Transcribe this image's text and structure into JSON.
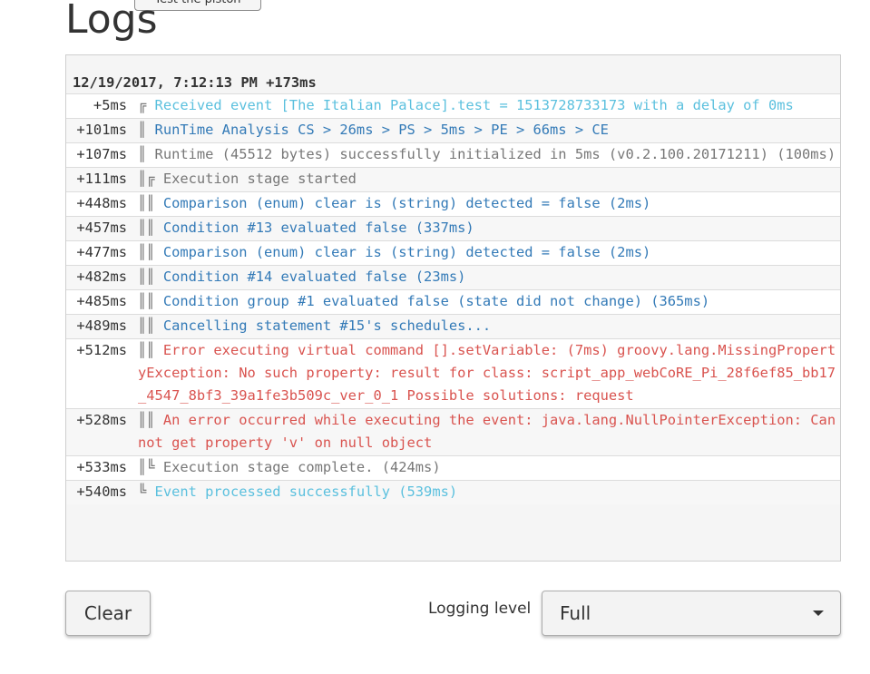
{
  "page": {
    "title": "Logs",
    "top_button_label": "Test the piston"
  },
  "log": {
    "header": "12/19/2017, 7:12:13 PM +173ms",
    "entries": [
      {
        "time": "+5ms",
        "prefix": "╔ ",
        "text": "Received event [The Italian Palace].test = 1513728733173 with a delay of 0ms",
        "level": "info"
      },
      {
        "time": "+101ms",
        "prefix": "║ ",
        "text": "RunTime Analysis CS > 26ms > PS > 5ms > PE > 66ms > CE",
        "level": "trace"
      },
      {
        "time": "+107ms",
        "prefix": "║ ",
        "text": "Runtime (45512 bytes) successfully initialized in 5ms (v0.2.100.20171211) (100ms)",
        "level": "plain"
      },
      {
        "time": "+111ms",
        "prefix": "║╔ ",
        "text": "Execution stage started",
        "level": "plain"
      },
      {
        "time": "+448ms",
        "prefix": "║║ ",
        "text": "Comparison (enum) clear is (string) detected = false (2ms)",
        "level": "trace"
      },
      {
        "time": "+457ms",
        "prefix": "║║ ",
        "text": "Condition #13 evaluated false (337ms)",
        "level": "trace"
      },
      {
        "time": "+477ms",
        "prefix": "║║ ",
        "text": "Comparison (enum) clear is (string) detected = false (2ms)",
        "level": "trace"
      },
      {
        "time": "+482ms",
        "prefix": "║║ ",
        "text": "Condition #14 evaluated false (23ms)",
        "level": "trace"
      },
      {
        "time": "+485ms",
        "prefix": "║║ ",
        "text": "Condition group #1 evaluated false (state did not change) (365ms)",
        "level": "trace"
      },
      {
        "time": "+489ms",
        "prefix": "║║ ",
        "text": "Cancelling statement #15's schedules...",
        "level": "trace"
      },
      {
        "time": "+512ms",
        "prefix": "║║ ",
        "text": "Error executing virtual command [].setVariable: (7ms) groovy.lang.MissingPropertyException: No such property: result for class: script_app_webCoRE_Pi_28f6ef85_bb17_4547_8bf3_39a1fe3b509c_ver_0_1 Possible solutions: request",
        "level": "error"
      },
      {
        "time": "+528ms",
        "prefix": "║║ ",
        "text": "An error occurred while executing the event: java.lang.NullPointerException: Cannot get property 'v' on null object",
        "level": "error"
      },
      {
        "time": "+533ms",
        "prefix": "║╚ ",
        "text": "Execution stage complete. (424ms)",
        "level": "plain"
      },
      {
        "time": "+540ms",
        "prefix": "╚ ",
        "text": "Event processed successfully (539ms)",
        "level": "info"
      }
    ]
  },
  "controls": {
    "clear_label": "Clear",
    "logging_level_label": "Logging level",
    "logging_level_value": "Full"
  },
  "colors": {
    "info": "#5bc0de",
    "trace": "#337ab7",
    "plain": "#777777",
    "error": "#d9534f"
  }
}
